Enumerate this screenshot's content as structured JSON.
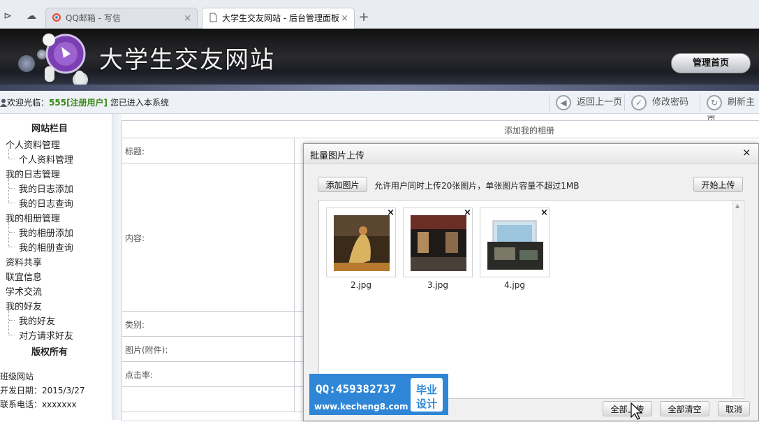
{
  "browser": {
    "tabs": [
      {
        "label": "QQ邮箱 - 写信"
      },
      {
        "label": "大学生交友网站 - 后台管理面板"
      }
    ],
    "new_tab": "+",
    "tab_close": "×"
  },
  "header": {
    "site_title": "大学生交友网站",
    "admin_home": "管理首页"
  },
  "welcome": {
    "prefix": "欢迎光临：",
    "user": "555[注册用户]",
    "suffix": " 您已进入本系统"
  },
  "toolbar": {
    "back": "返回上一页",
    "change_password": "修改密码",
    "refresh": "刷新主页"
  },
  "sidebar": {
    "heading": "网站栏目",
    "items": [
      {
        "label": "个人资料管理"
      },
      {
        "label": "个人资料管理"
      },
      {
        "label": "我的日志管理"
      },
      {
        "label": "我的日志添加"
      },
      {
        "label": "我的日志查询"
      },
      {
        "label": "我的相册管理"
      },
      {
        "label": "我的相册添加"
      },
      {
        "label": "我的相册查询"
      },
      {
        "label": "资料共享"
      },
      {
        "label": "联宜信息"
      },
      {
        "label": "学术交流"
      },
      {
        "label": "我的好友"
      },
      {
        "label": "我的好友"
      },
      {
        "label": "对方请求好友"
      }
    ],
    "copyright_heading": "版权所有",
    "info": [
      "班级网站",
      "开发日期：2015/3/27",
      "联系电话：xxxxxxx"
    ]
  },
  "form": {
    "title": "添加我的相册",
    "rows": [
      {
        "label": "标题:"
      },
      {
        "label": "内容:"
      },
      {
        "label": "类别:"
      },
      {
        "label": "图片(附件):"
      },
      {
        "label": "点击率:"
      }
    ]
  },
  "dialog": {
    "title": "批量图片上传",
    "close": "×",
    "add_button": "添加图片",
    "hint": "允许用户同时上传20张图片，单张图片容量不超过1MB",
    "start_button": "开始上传",
    "images": [
      {
        "name": "2.jpg"
      },
      {
        "name": "3.jpg"
      },
      {
        "name": "4.jpg"
      }
    ],
    "remove": "×",
    "buttons": {
      "upload_all": "全部上传",
      "clear_all": "全部清空",
      "cancel": "取消"
    }
  },
  "watermark": {
    "qq": "QQ:459382737",
    "url": "www.kecheng8.com",
    "tag_line1": "毕业",
    "tag_line2": "设计"
  },
  "colors": {
    "user_green": "#3a8a1c",
    "watermark_blue": "#2f86d6"
  }
}
